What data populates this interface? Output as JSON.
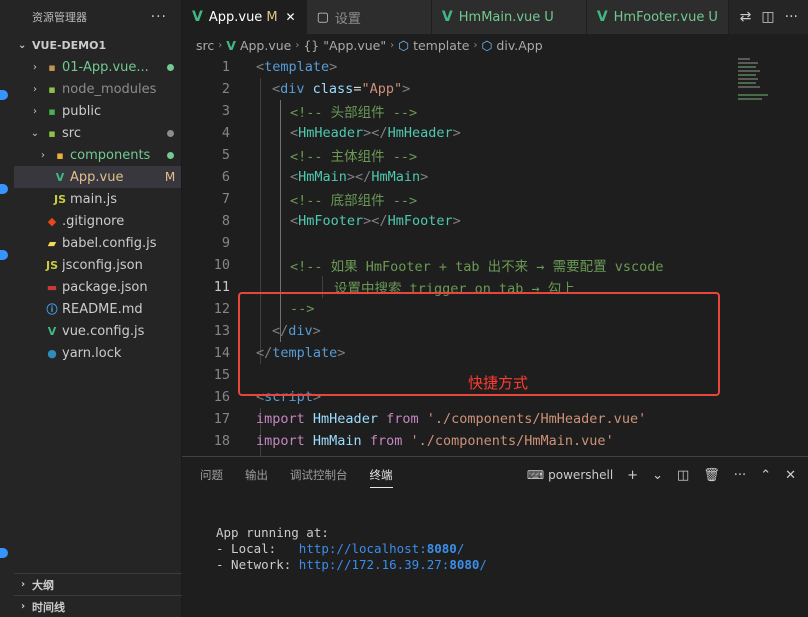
{
  "sidebar": {
    "title": "资源管理器",
    "more": "···",
    "project": "VUE-DEMO1",
    "items": [
      {
        "name": "01-App.vue...",
        "icon": "folder-icon",
        "badge": "dot",
        "indent": 1,
        "chev": "›"
      },
      {
        "name": "node_modules",
        "icon": "folder-icon",
        "badge": "",
        "indent": 1,
        "chev": "›"
      },
      {
        "name": "public",
        "icon": "folder-icon",
        "badge": "",
        "indent": 1,
        "chev": "›"
      },
      {
        "name": "src",
        "icon": "folder-icon",
        "badge": "dot",
        "indent": 1,
        "chev": "⌄"
      },
      {
        "name": "components",
        "icon": "folder-icon",
        "badge": "dot",
        "indent": 2,
        "chev": "›"
      },
      {
        "name": "App.vue",
        "icon": "vue-icon",
        "badge": "M",
        "indent": 2,
        "chev": ""
      },
      {
        "name": "main.js",
        "icon": "js-icon",
        "badge": "",
        "indent": 2,
        "chev": ""
      },
      {
        "name": ".gitignore",
        "icon": "git-icon",
        "badge": "",
        "indent": 1,
        "chev": ""
      },
      {
        "name": "babel.config.js",
        "icon": "babel-icon",
        "badge": "",
        "indent": 1,
        "chev": ""
      },
      {
        "name": "jsconfig.json",
        "icon": "js-icon",
        "badge": "",
        "indent": 1,
        "chev": ""
      },
      {
        "name": "package.json",
        "icon": "npm-icon",
        "badge": "",
        "indent": 1,
        "chev": ""
      },
      {
        "name": "README.md",
        "icon": "info-icon",
        "badge": "",
        "indent": 1,
        "chev": ""
      },
      {
        "name": "vue.config.js",
        "icon": "vue-icon",
        "badge": "",
        "indent": 1,
        "chev": ""
      },
      {
        "name": "yarn.lock",
        "icon": "yarn-icon",
        "badge": "",
        "indent": 1,
        "chev": ""
      }
    ],
    "outline": "大纲",
    "timeline": "时间线"
  },
  "tabs": [
    {
      "label": "App.vue",
      "suffix": "M",
      "active": true
    },
    {
      "label": "设置",
      "suffix": "",
      "active": false
    },
    {
      "label": "HmMain.vue",
      "suffix": "U",
      "active": false
    },
    {
      "label": "HmFooter.vue",
      "suffix": "U",
      "active": false
    }
  ],
  "breadcrumb": [
    "src",
    "App.vue",
    "{} \"App.vue\"",
    "template",
    "div.App"
  ],
  "code": {
    "line_numbers": [
      "1",
      "2",
      "3",
      "4",
      "5",
      "6",
      "7",
      "8",
      "9",
      "10",
      "11",
      "12",
      "13",
      "14",
      "15",
      "16",
      "17",
      "18"
    ],
    "current_line": "11",
    "l1": "template",
    "l2_tag": "div",
    "l2_attr": "class",
    "l2_val": "\"App\"",
    "l3": "<!-- 头部组件 -->",
    "l4": "HmHeader",
    "l5": "<!-- 主体组件 -->",
    "l6": "HmMain",
    "l7": "<!-- 底部组件 -->",
    "l8": "HmFooter",
    "l10": "<!-- 如果 HmFooter + tab 出不来 → 需要配置 vscode",
    "l11": "设置中搜索 trigger on tab → 勾上",
    "l12": "-->",
    "l13": "div",
    "l14": "template",
    "l16": "script",
    "l17_kw": "import",
    "l17_var": "HmHeader",
    "l17_from": "from",
    "l17_str": "'./components/HmHeader.vue'",
    "l18_kw": "import",
    "l18_var": "HmMain",
    "l18_from": "from",
    "l18_str": "'./components/HmMain.vue'"
  },
  "annotation": "快捷方式",
  "annotation_color": "#e8453c",
  "panel": {
    "tabs": [
      "问题",
      "输出",
      "调试控制台",
      "终端"
    ],
    "active_tab": "终端",
    "shell": "powershell",
    "terminal": {
      "running": "App running at:",
      "local_label": "- Local:   ",
      "local_url": "http://localhost:",
      "local_port": "8080",
      "network_label": "- Network: ",
      "network_url": "http://172.16.39.27:",
      "network_port": "8080",
      "slash": "/"
    }
  }
}
